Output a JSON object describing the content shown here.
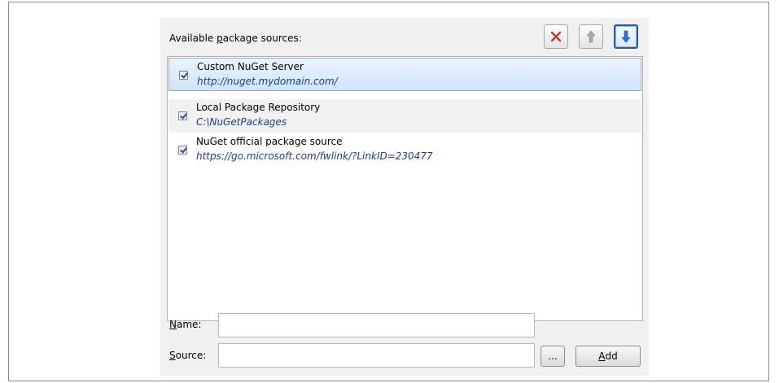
{
  "header": {
    "title_prefix": "Available ",
    "title_accel": "p",
    "title_suffix": "ackage sources:"
  },
  "toolbar": {
    "remove": "remove-icon",
    "move_up": "arrow-up-icon",
    "move_down": "arrow-down-icon",
    "colors": {
      "remove": "#c0392b",
      "up": "#9a9a9a",
      "down": "#2f6fd6"
    }
  },
  "sources": [
    {
      "name": "Custom NuGet Server",
      "url": "http://nuget.mydomain.com/",
      "enabled": true,
      "selected": true
    },
    {
      "name": "Local Package Repository",
      "url": "C:\\NuGetPackages",
      "enabled": true,
      "selected": false
    },
    {
      "name": "NuGet official package source",
      "url": "https://go.microsoft.com/fwlink/?LinkID=230477",
      "enabled": true,
      "selected": false
    }
  ],
  "form": {
    "name_accel": "N",
    "name_rest": "ame:",
    "name_value": "",
    "source_accel": "S",
    "source_rest": "ource:",
    "source_value": "",
    "browse_label": "...",
    "add_accel": "A",
    "add_rest": "dd"
  }
}
